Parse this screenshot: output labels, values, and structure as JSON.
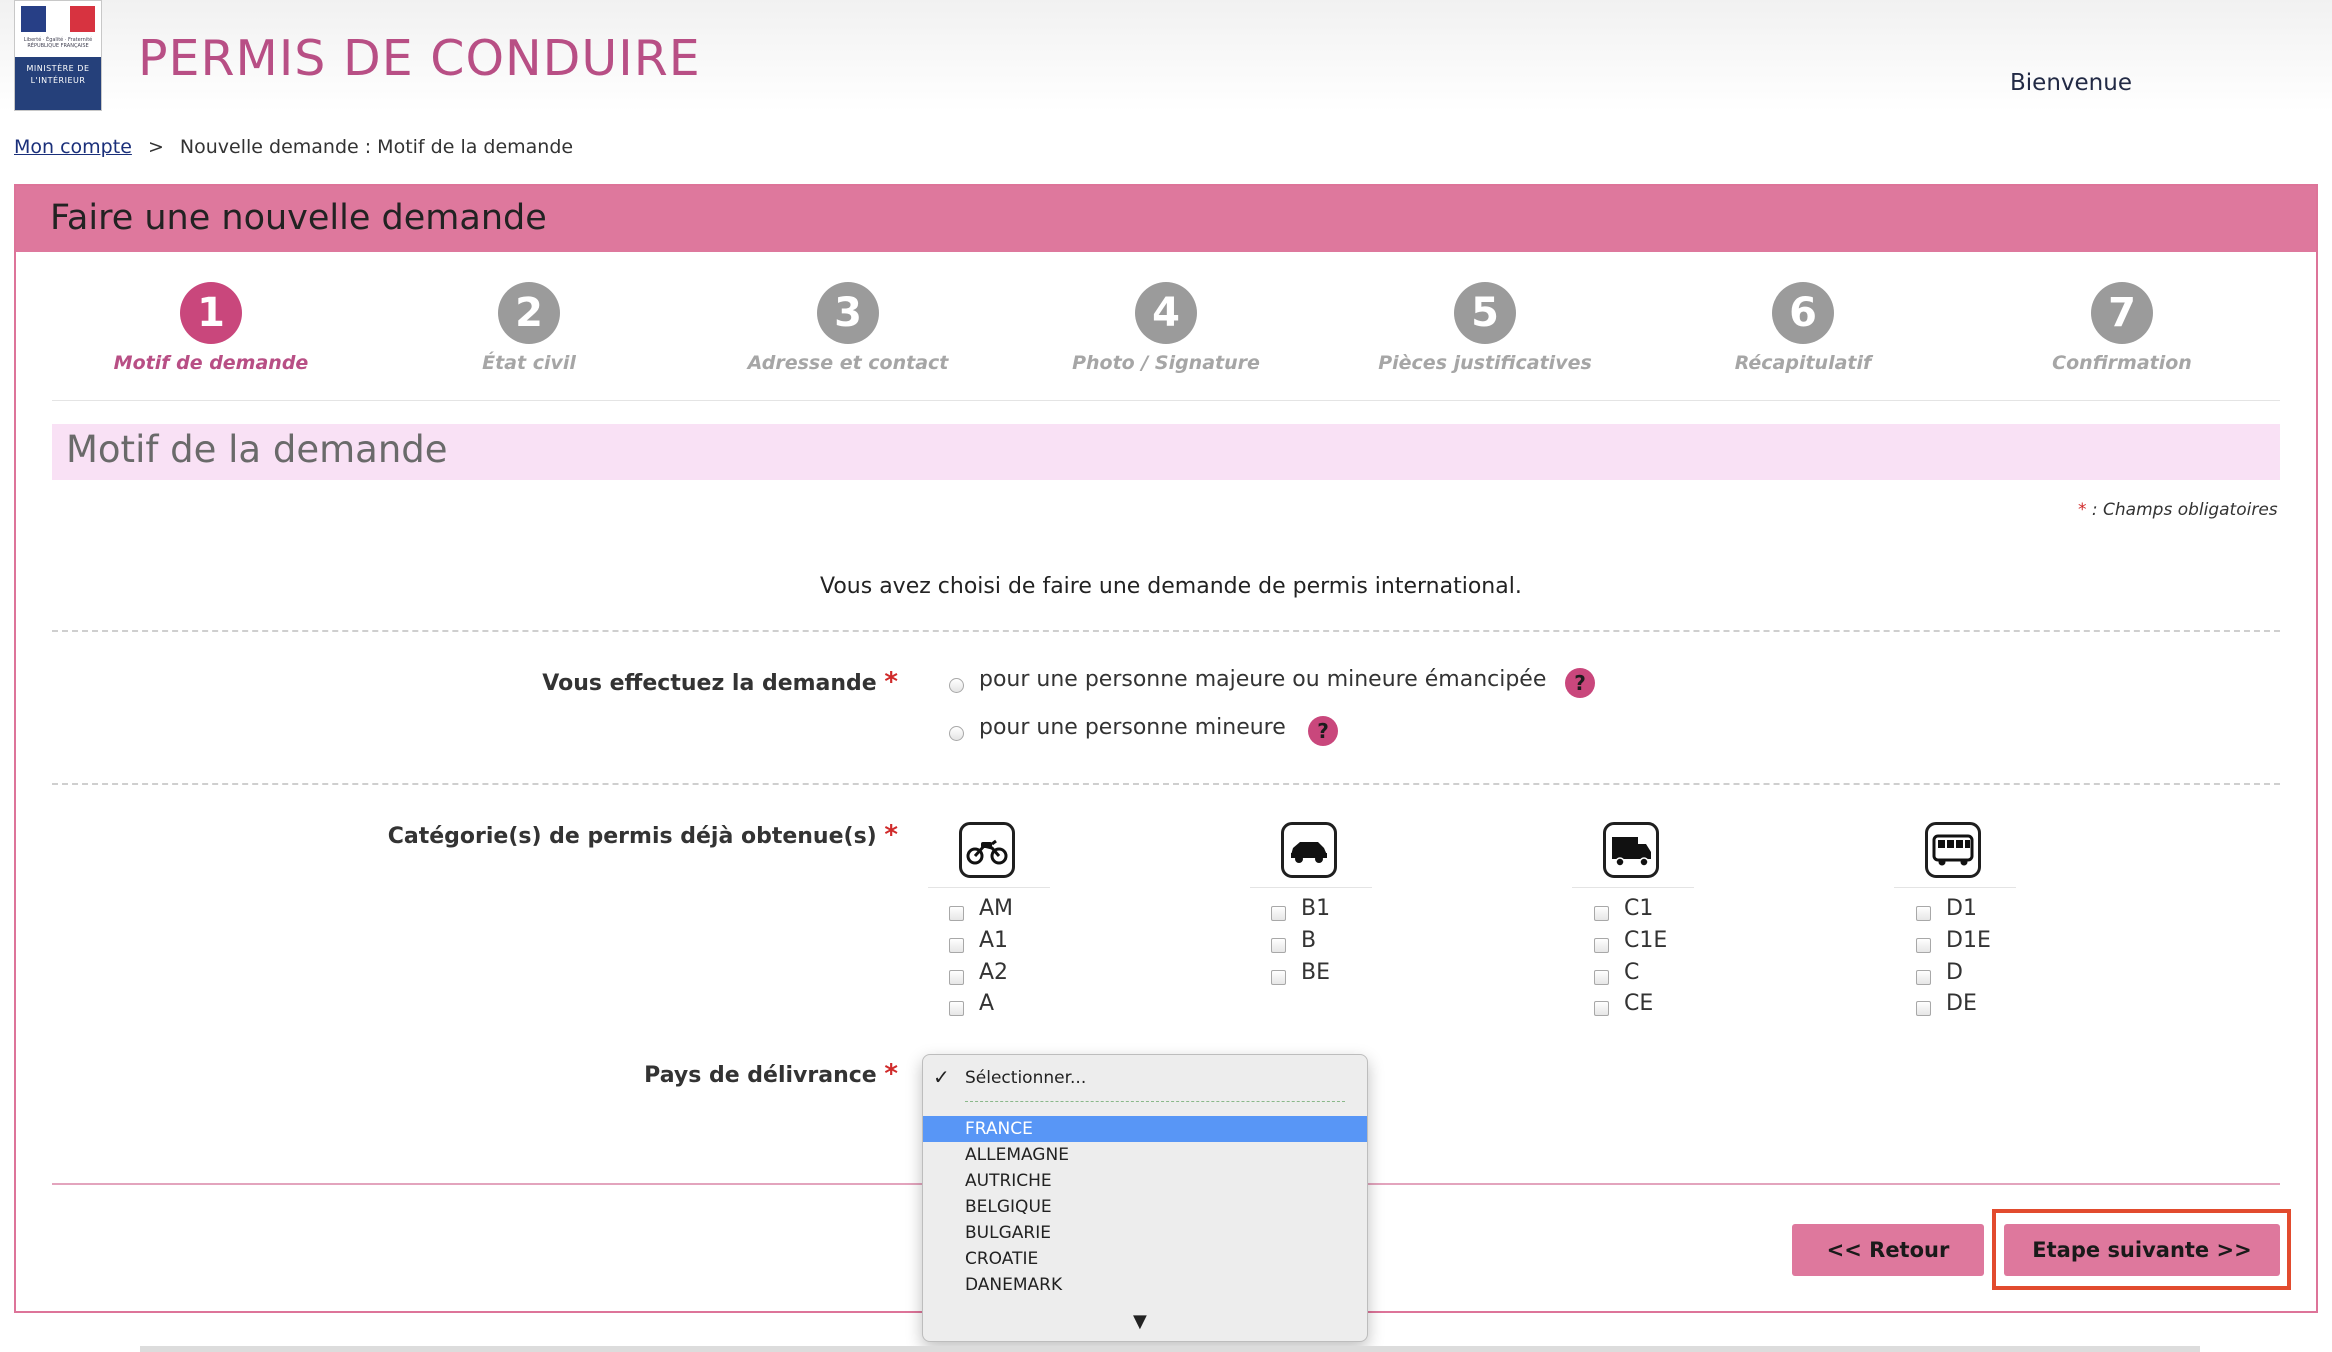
{
  "header": {
    "logo_text": "MINISTÈRE DE L'INTÉRIEUR",
    "logo_subtext": "Liberté · Égalité · Fraternité RÉPUBLIQUE FRANÇAISE",
    "app_title": "PERMIS DE CONDUIRE",
    "welcome": "Bienvenue"
  },
  "breadcrumb": {
    "link": "Mon compte",
    "separator": ">",
    "current": "Nouvelle demande : Motif de la demande"
  },
  "panel": {
    "title": "Faire une nouvelle demande"
  },
  "steps": [
    {
      "number": "1",
      "label": "Motif de demande",
      "active": true
    },
    {
      "number": "2",
      "label": "État civil",
      "active": false
    },
    {
      "number": "3",
      "label": "Adresse et contact",
      "active": false
    },
    {
      "number": "4",
      "label": "Photo / Signature",
      "active": false
    },
    {
      "number": "5",
      "label": "Pièces justificatives",
      "active": false
    },
    {
      "number": "6",
      "label": "Récapitulatif",
      "active": false
    },
    {
      "number": "7",
      "label": "Confirmation",
      "active": false
    }
  ],
  "section": {
    "title": "Motif de la demande",
    "mandatory_star": "*",
    "mandatory_note": ": Champs obligatoires",
    "info": "Vous avez choisi de faire une demande de permis international."
  },
  "request_for": {
    "label": "Vous effectuez la demande",
    "required": "*",
    "options": [
      "pour une personne majeure ou mineure émancipée",
      "pour une personne mineure"
    ],
    "help": "?"
  },
  "categories": {
    "label": "Catégorie(s) de permis déjà obtenue(s)",
    "required": "*",
    "groups": [
      {
        "icon": "motorcycle-icon",
        "items": [
          "AM",
          "A1",
          "A2",
          "A"
        ]
      },
      {
        "icon": "car-icon",
        "items": [
          "B1",
          "B",
          "BE"
        ]
      },
      {
        "icon": "truck-icon",
        "items": [
          "C1",
          "C1E",
          "C",
          "CE"
        ]
      },
      {
        "icon": "bus-icon",
        "items": [
          "D1",
          "D1E",
          "D",
          "DE"
        ]
      }
    ]
  },
  "country": {
    "label": "Pays de délivrance",
    "required": "*",
    "placeholder": "Sélectionner...",
    "selected": "FRANCE",
    "options": [
      "FRANCE",
      "ALLEMAGNE",
      "AUTRICHE",
      "BELGIQUE",
      "BULGARIE",
      "CROATIE",
      "DANEMARK"
    ]
  },
  "buttons": {
    "back": "<<  Retour",
    "next": "Etape suivante  >>"
  },
  "colors": {
    "brand": "#b84f85",
    "panel_header": "#de789d",
    "active_step": "#c9477c",
    "inactive_step": "#9b9b9b",
    "section_bg": "#f9e1f5",
    "dropdown_selected": "#5896f6",
    "highlight": "#e24b2e"
  }
}
